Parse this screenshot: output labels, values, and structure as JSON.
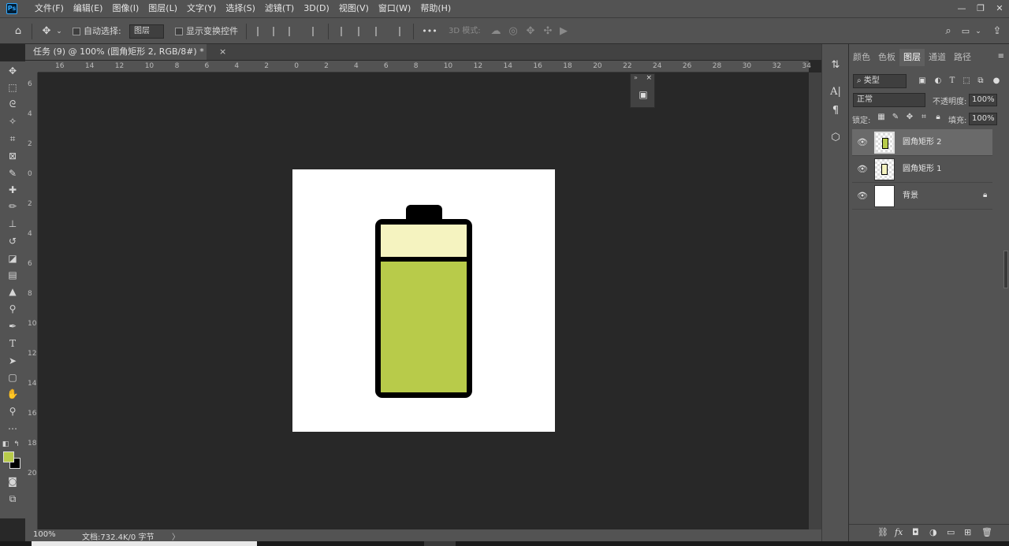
{
  "app": {
    "logo": "Ps",
    "menus": [
      "文件(F)",
      "编辑(E)",
      "图像(I)",
      "图层(L)",
      "文字(Y)",
      "选择(S)",
      "滤镜(T)",
      "3D(D)",
      "视图(V)",
      "窗口(W)",
      "帮助(H)"
    ],
    "window_controls": [
      "—",
      "❐",
      "✕"
    ]
  },
  "options_bar": {
    "auto_select_label": "自动选择:",
    "auto_select_value": "图层",
    "show_transform_label": "显示变换控件",
    "mode_3d_label": "3D 模式:",
    "more_label": "•••"
  },
  "document": {
    "tab_title": "任务 (9) @ 100% (圆角矩形 2, RGB/8#) *",
    "close": "×"
  },
  "rulers": {
    "top": [
      "16",
      "14",
      "12",
      "10",
      "8",
      "6",
      "4",
      "2",
      "0",
      "2",
      "4",
      "6",
      "8",
      "10",
      "12",
      "14",
      "16",
      "18",
      "20",
      "22",
      "24",
      "26",
      "28",
      "30",
      "32",
      "34"
    ],
    "left": [
      "6",
      "4",
      "2",
      "0",
      "2",
      "4",
      "6",
      "8",
      "10",
      "12",
      "14",
      "16",
      "18",
      "20"
    ]
  },
  "status": {
    "zoom": "100%",
    "doc_info": "文档:732.4K/0 字节",
    "arrow": "〉"
  },
  "battery": {
    "outline_color": "#000000",
    "fill_color": "#b8cb4a",
    "cap_color": "#f5f3c0",
    "fill_level": 0.78
  },
  "colors": {
    "foreground": "#b8cb4a",
    "background": "#000000",
    "ui_panel": "#535353",
    "workspace": "#282828"
  },
  "layers_panel": {
    "tabs": [
      "颜色",
      "色板",
      "图层",
      "通道",
      "路径"
    ],
    "active_tab": "图层",
    "filter_label": "类型",
    "blend_mode": "正常",
    "opacity_label": "不透明度:",
    "opacity_value": "100%",
    "lock_label": "锁定:",
    "fill_label": "填充:",
    "fill_value": "100%",
    "layers": [
      {
        "name": "圆角矩形 2",
        "selected": true
      },
      {
        "name": "圆角矩形 1",
        "selected": false
      },
      {
        "name": "背景",
        "selected": false,
        "locked": true
      }
    ],
    "footer_icons": [
      "link-icon",
      "fx-icon",
      "mask-icon",
      "adjustment-icon",
      "folder-icon",
      "new-layer-icon",
      "trash-icon"
    ]
  }
}
